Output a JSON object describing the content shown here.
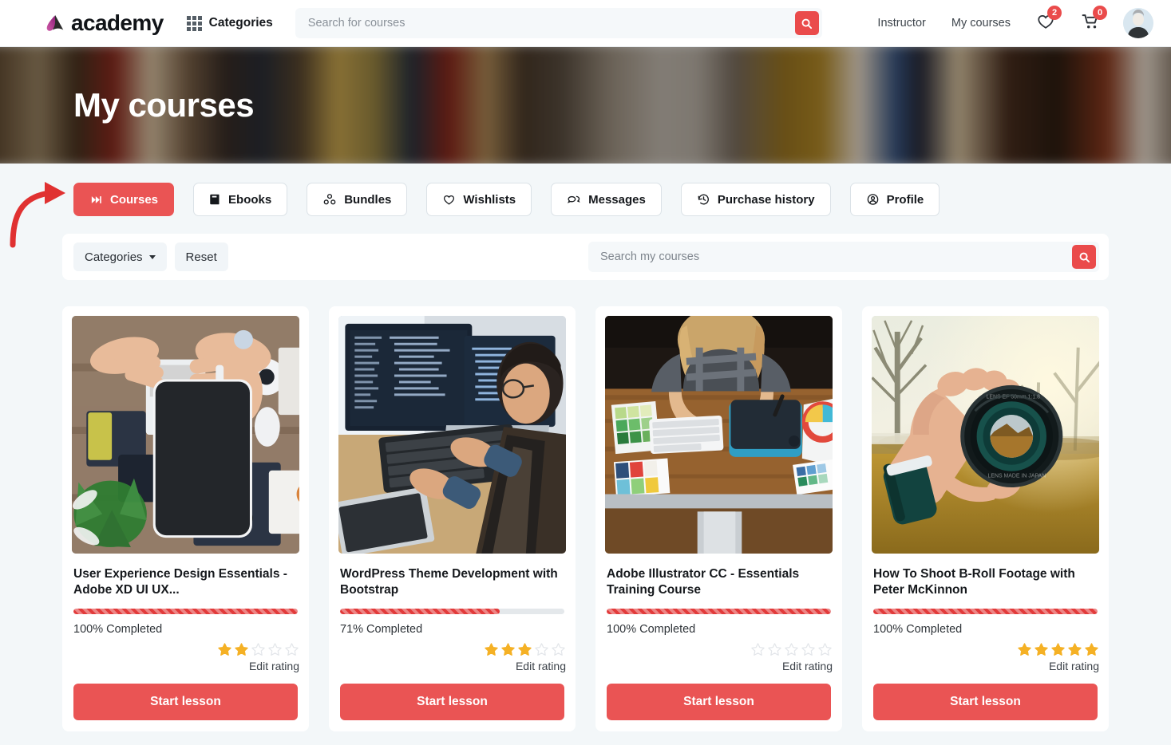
{
  "header": {
    "logo_text": "academy",
    "logo_icon": "academy-a-mark",
    "categories_label": "Categories",
    "categories_icon": "grid-icon",
    "search": {
      "placeholder": "Search for courses",
      "value": "",
      "button_icon": "search-icon"
    },
    "links": [
      {
        "label": "Instructor"
      },
      {
        "label": "My courses"
      }
    ],
    "wishlist": {
      "icon": "heart-icon",
      "badge": "2"
    },
    "cart": {
      "icon": "cart-icon",
      "badge": "0"
    },
    "avatar": {
      "icon": "avatar"
    }
  },
  "hero": {
    "title": "My courses"
  },
  "tabs": [
    {
      "label": "Courses",
      "icon": "skip-forward-icon",
      "active": true
    },
    {
      "label": "Ebooks",
      "icon": "book-icon",
      "active": false
    },
    {
      "label": "Bundles",
      "icon": "bundles-icon",
      "active": false
    },
    {
      "label": "Wishlists",
      "icon": "heart-icon",
      "active": false
    },
    {
      "label": "Messages",
      "icon": "chat-bubbles-icon",
      "active": false
    },
    {
      "label": "Purchase history",
      "icon": "history-clock-icon",
      "active": false
    },
    {
      "label": "Profile",
      "icon": "user-circle-icon",
      "active": false
    }
  ],
  "annotation": {
    "arrow_icon": "curved-arrow-icon",
    "arrow_color": "#e03131",
    "points_to": "Courses"
  },
  "filters": {
    "categories_label": "Categories",
    "reset_label": "Reset",
    "search": {
      "placeholder": "Search my courses",
      "value": "",
      "button_icon": "search-icon"
    }
  },
  "colors": {
    "accent_red": "#ea5454",
    "progress_red": "#e23b3b",
    "star_gold": "#f5b125",
    "star_empty": "#e3e6ea",
    "page_bg": "#f3f7f9",
    "logo_magenta": "#b4288c"
  },
  "courses": [
    {
      "title": "User Experience Design Essentials - Adobe XD UI UX...",
      "progress_percent": 100,
      "progress_label": "100% Completed",
      "rating": 2,
      "stars_total": 5,
      "edit_rating_label": "Edit rating",
      "start_label": "Start lesson",
      "image_alt": "hands-holding-smartphone-over-desk"
    },
    {
      "title": "WordPress Theme Development with Bootstrap",
      "progress_percent": 71,
      "progress_label": "71% Completed",
      "rating": 3,
      "stars_total": 5,
      "edit_rating_label": "Edit rating",
      "start_label": "Start lesson",
      "image_alt": "developer-coding-on-dual-monitors"
    },
    {
      "title": "Adobe Illustrator CC - Essentials Training Course",
      "progress_percent": 100,
      "progress_label": "100% Completed",
      "rating": 0,
      "stars_total": 5,
      "edit_rating_label": "Edit rating",
      "start_label": "Start lesson",
      "image_alt": "designer-with-drawing-tablet-and-color-swatches"
    },
    {
      "title": "How To Shoot B-Roll Footage with Peter McKinnon",
      "progress_percent": 100,
      "progress_label": "100% Completed",
      "rating": 5,
      "stars_total": 5,
      "edit_rating_label": "Edit rating",
      "start_label": "Start lesson",
      "image_alt": "hand-holding-camera-lens-autumn-field"
    }
  ]
}
